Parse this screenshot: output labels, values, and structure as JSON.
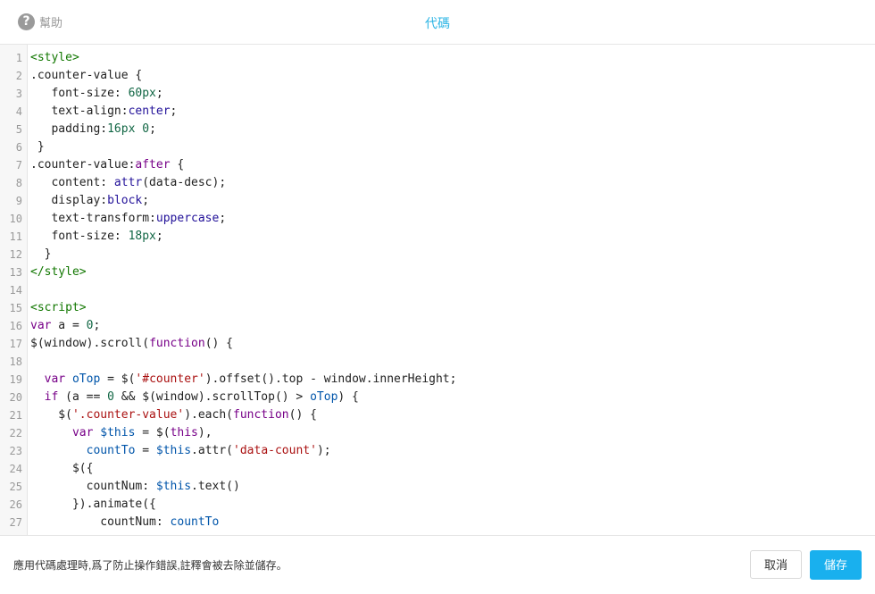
{
  "header": {
    "help_icon_glyph": "?",
    "help_label": "幫助",
    "title": "代碼"
  },
  "editor": {
    "lines": [
      {
        "n": "1",
        "tokens": [
          [
            "<style>",
            "tag"
          ]
        ]
      },
      {
        "n": "2",
        "tokens": [
          [
            ".counter-value {",
            ""
          ]
        ]
      },
      {
        "n": "3",
        "tokens": [
          [
            "   font-size: ",
            ""
          ],
          [
            "60px",
            "num"
          ],
          [
            ";",
            ""
          ]
        ]
      },
      {
        "n": "4",
        "tokens": [
          [
            "   text-align:",
            ""
          ],
          [
            "center",
            "atom"
          ],
          [
            ";",
            ""
          ]
        ]
      },
      {
        "n": "5",
        "tokens": [
          [
            "   padding:",
            ""
          ],
          [
            "16px 0",
            "num"
          ],
          [
            ";",
            ""
          ]
        ]
      },
      {
        "n": "6",
        "tokens": [
          [
            " }",
            ""
          ]
        ]
      },
      {
        "n": "7",
        "tokens": [
          [
            ".counter-value:",
            ""
          ],
          [
            "after",
            "kw"
          ],
          [
            " {",
            ""
          ]
        ]
      },
      {
        "n": "8",
        "tokens": [
          [
            "   content: ",
            ""
          ],
          [
            "attr",
            "atom"
          ],
          [
            "(data-desc);",
            ""
          ]
        ]
      },
      {
        "n": "9",
        "tokens": [
          [
            "   display:",
            ""
          ],
          [
            "block",
            "atom"
          ],
          [
            ";",
            ""
          ]
        ]
      },
      {
        "n": "10",
        "tokens": [
          [
            "   text-transform:",
            ""
          ],
          [
            "uppercase",
            "atom"
          ],
          [
            ";",
            ""
          ]
        ]
      },
      {
        "n": "11",
        "tokens": [
          [
            "   font-size: ",
            ""
          ],
          [
            "18px",
            "num"
          ],
          [
            ";",
            ""
          ]
        ]
      },
      {
        "n": "12",
        "tokens": [
          [
            "  }",
            ""
          ]
        ]
      },
      {
        "n": "13",
        "tokens": [
          [
            "</style>",
            "tag"
          ]
        ]
      },
      {
        "n": "14",
        "tokens": [
          [
            "",
            ""
          ]
        ]
      },
      {
        "n": "15",
        "tokens": [
          [
            "<script>",
            "tag"
          ]
        ]
      },
      {
        "n": "16",
        "tokens": [
          [
            "var",
            "kw"
          ],
          [
            " a = ",
            ""
          ],
          [
            "0",
            "num"
          ],
          [
            ";",
            ""
          ]
        ]
      },
      {
        "n": "17",
        "tokens": [
          [
            "$(window).scroll(",
            ""
          ],
          [
            "function",
            "kw"
          ],
          [
            "() {",
            ""
          ]
        ]
      },
      {
        "n": "18",
        "tokens": [
          [
            "",
            ""
          ]
        ]
      },
      {
        "n": "19",
        "tokens": [
          [
            "  ",
            ""
          ],
          [
            "var",
            "kw"
          ],
          [
            " ",
            ""
          ],
          [
            "oTop",
            "def"
          ],
          [
            " = $(",
            ""
          ],
          [
            "'#counter'",
            "str"
          ],
          [
            ").offset().top - window.innerHeight;",
            ""
          ]
        ]
      },
      {
        "n": "20",
        "tokens": [
          [
            "  ",
            ""
          ],
          [
            "if",
            "kw"
          ],
          [
            " (a == ",
            ""
          ],
          [
            "0",
            "num"
          ],
          [
            " && $(window).scrollTop() > ",
            ""
          ],
          [
            "oTop",
            "var2"
          ],
          [
            ") {",
            ""
          ]
        ]
      },
      {
        "n": "21",
        "tokens": [
          [
            "    $(",
            ""
          ],
          [
            "'.counter-value'",
            "str"
          ],
          [
            ").each(",
            ""
          ],
          [
            "function",
            "kw"
          ],
          [
            "() {",
            ""
          ]
        ]
      },
      {
        "n": "22",
        "tokens": [
          [
            "      ",
            ""
          ],
          [
            "var",
            "kw"
          ],
          [
            " ",
            ""
          ],
          [
            "$this",
            "def"
          ],
          [
            " = $(",
            ""
          ],
          [
            "this",
            "kw"
          ],
          [
            "),",
            ""
          ]
        ]
      },
      {
        "n": "23",
        "tokens": [
          [
            "        ",
            ""
          ],
          [
            "countTo",
            "def"
          ],
          [
            " = ",
            ""
          ],
          [
            "$this",
            "var2"
          ],
          [
            ".attr(",
            ""
          ],
          [
            "'data-count'",
            "str"
          ],
          [
            ");",
            ""
          ]
        ]
      },
      {
        "n": "24",
        "tokens": [
          [
            "      $({",
            ""
          ]
        ]
      },
      {
        "n": "25",
        "tokens": [
          [
            "        countNum: ",
            ""
          ],
          [
            "$this",
            "var2"
          ],
          [
            ".text()",
            ""
          ]
        ]
      },
      {
        "n": "26",
        "tokens": [
          [
            "      }).animate({",
            ""
          ]
        ]
      },
      {
        "n": "27",
        "tokens": [
          [
            "          countNum: ",
            ""
          ],
          [
            "countTo",
            "var2"
          ]
        ]
      }
    ]
  },
  "footer": {
    "notice": "應用代碼處理時,爲了防止操作錯誤,註釋會被去除並儲存。",
    "cancel_label": "取消",
    "save_label": "儲存"
  }
}
